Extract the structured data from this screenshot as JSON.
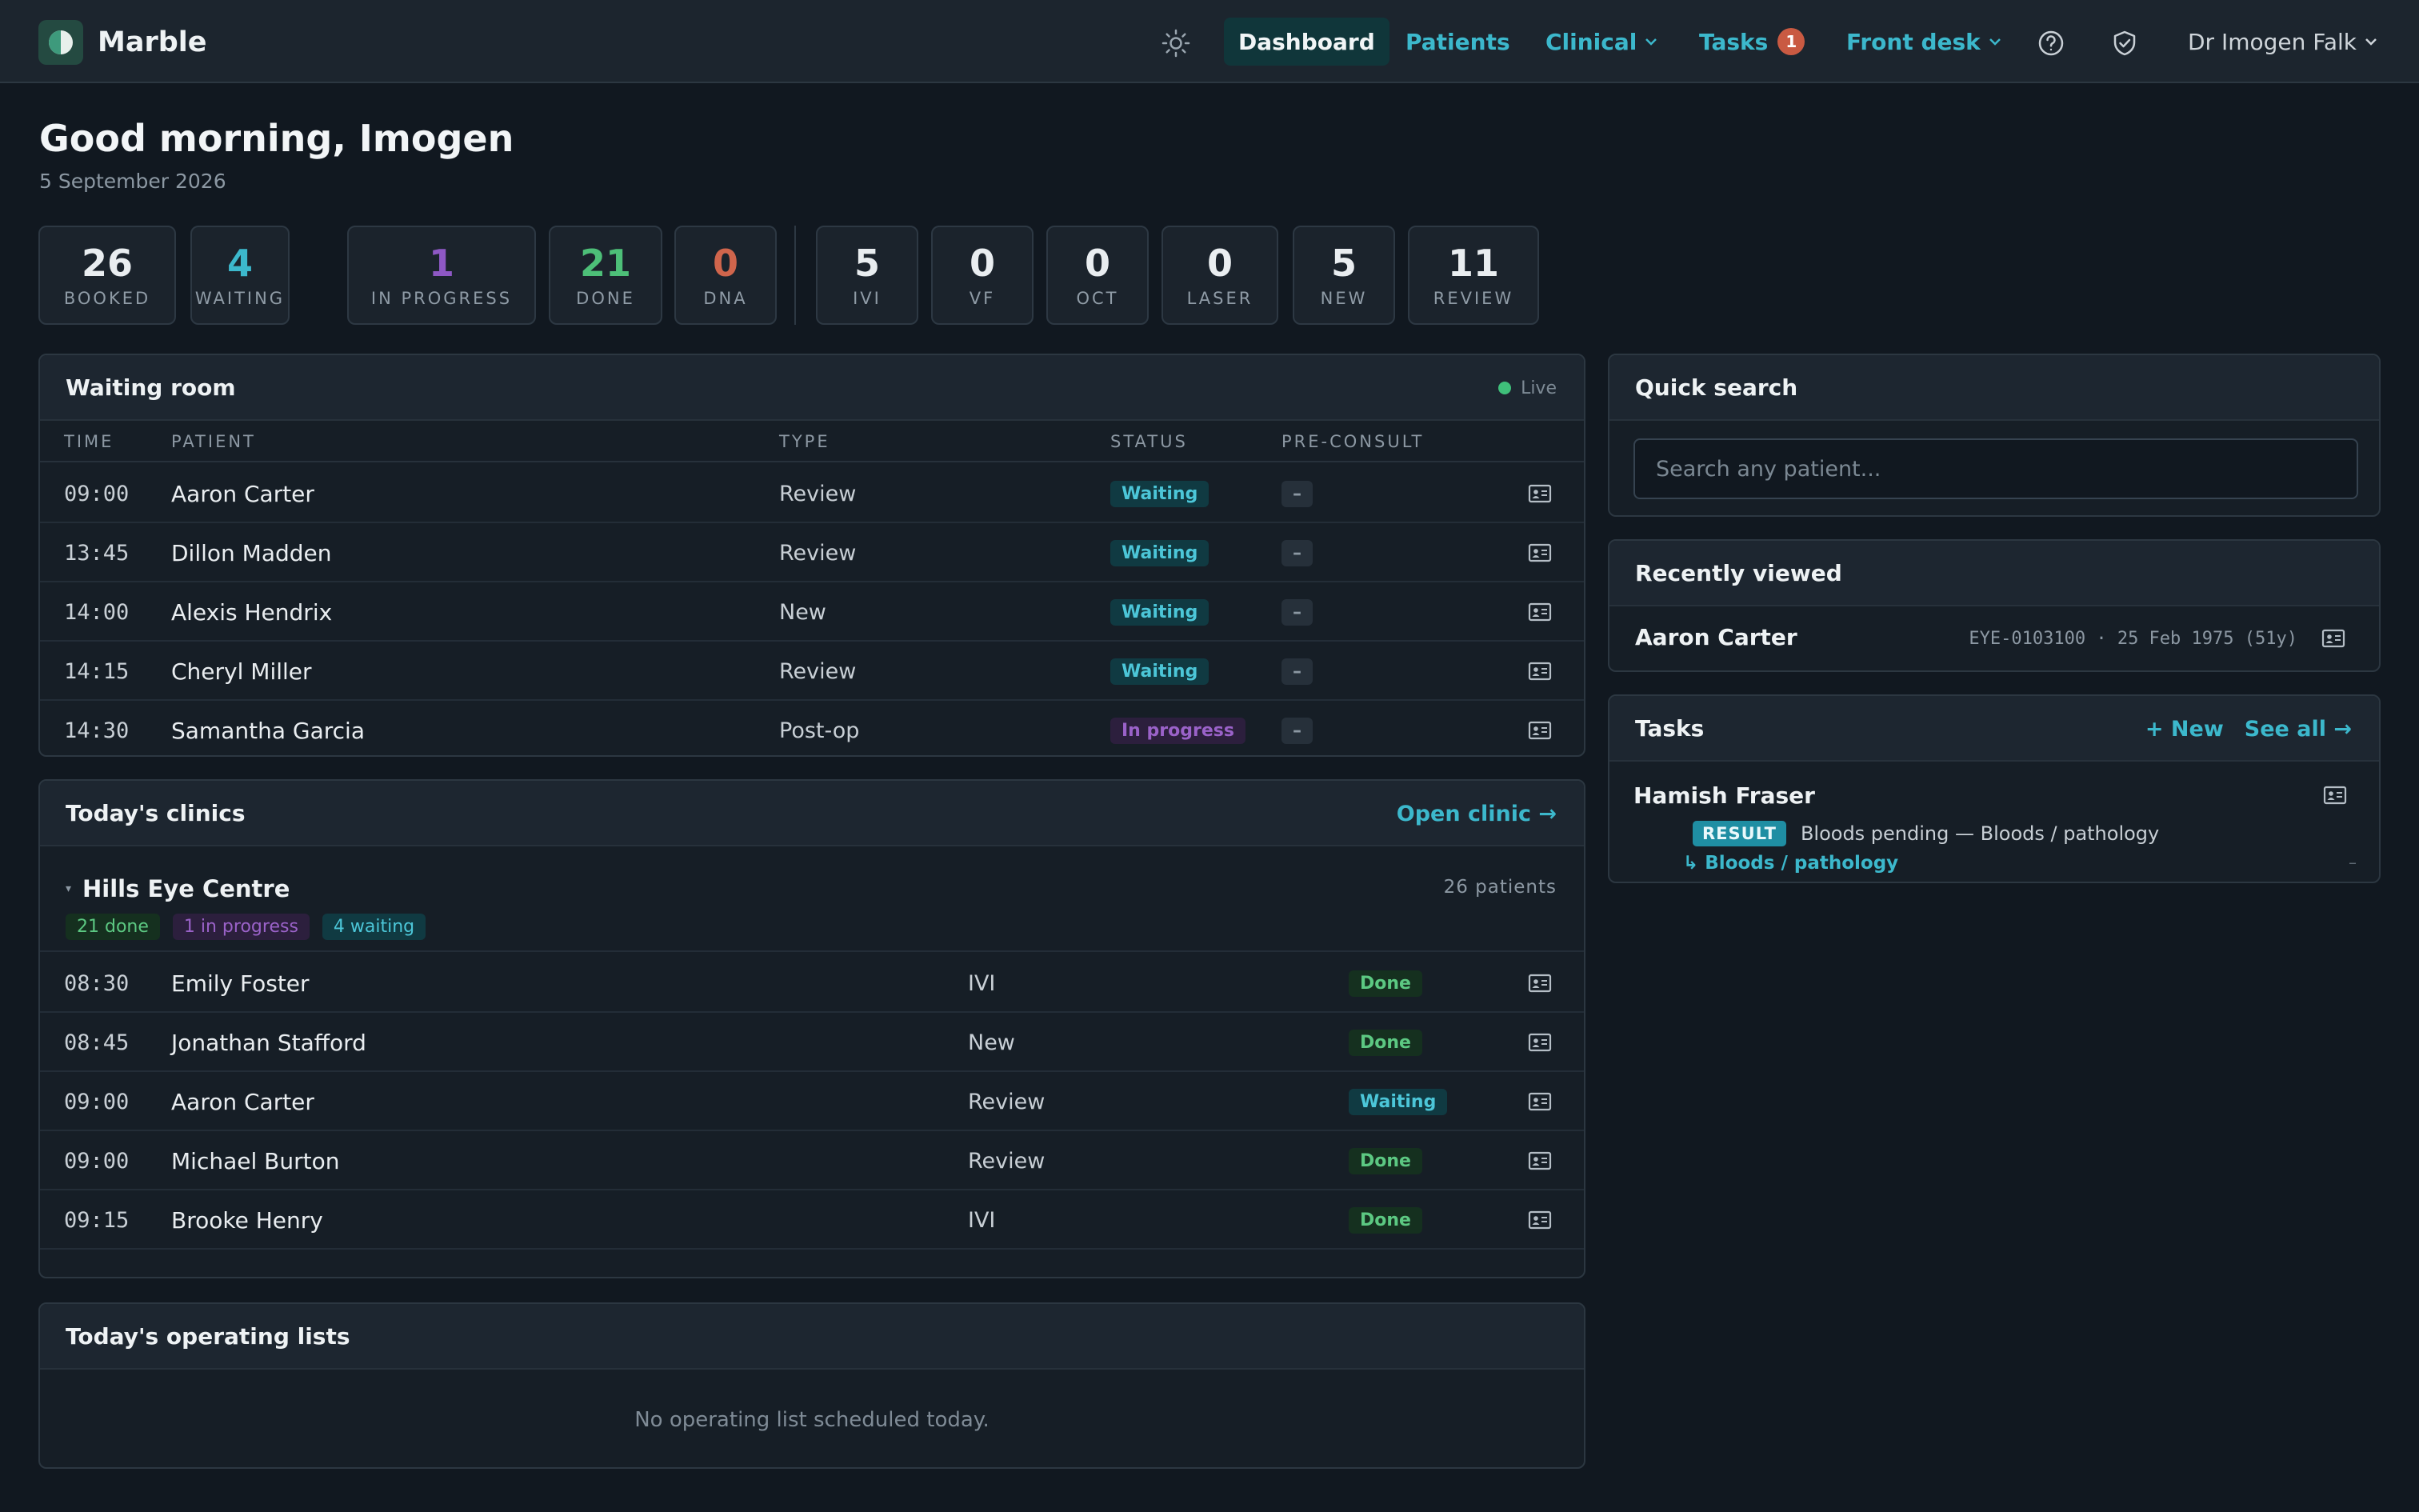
{
  "app": {
    "name": "Marble"
  },
  "nav": {
    "dashboard": "Dashboard",
    "patients": "Patients",
    "clinical": "Clinical",
    "tasks": "Tasks",
    "tasks_count": "1",
    "front_desk": "Front desk",
    "user": "Dr Imogen Falk"
  },
  "greeting": {
    "title": "Good morning, Imogen",
    "date": "5 September 2026"
  },
  "stats": [
    {
      "value": "26",
      "label": "BOOKED",
      "color": "#e9edf0"
    },
    {
      "value": "4",
      "label": "WAITING",
      "color": "#3cb8cc"
    },
    {
      "value": "1",
      "label": "IN PROGRESS",
      "color": "#8e58c4"
    },
    {
      "value": "21",
      "label": "DONE",
      "color": "#4dbf78"
    },
    {
      "value": "0",
      "label": "DNA",
      "color": "#d0654c"
    },
    {
      "value": "5",
      "label": "IVI",
      "color": "#e9edf0"
    },
    {
      "value": "0",
      "label": "VF",
      "color": "#e9edf0"
    },
    {
      "value": "0",
      "label": "OCT",
      "color": "#e9edf0"
    },
    {
      "value": "0",
      "label": "LASER",
      "color": "#e9edf0"
    },
    {
      "value": "5",
      "label": "NEW",
      "color": "#e9edf0"
    },
    {
      "value": "11",
      "label": "REVIEW",
      "color": "#e9edf0"
    }
  ],
  "waiting_room": {
    "title": "Waiting room",
    "live": "Live",
    "columns": {
      "time": "TIME",
      "patient": "PATIENT",
      "type": "TYPE",
      "status": "STATUS",
      "preconsult": "PRE-CONSULT"
    },
    "rows": [
      {
        "time": "09:00",
        "patient": "Aaron Carter",
        "type": "Review",
        "status": "Waiting",
        "preconsult": "–"
      },
      {
        "time": "13:45",
        "patient": "Dillon Madden",
        "type": "Review",
        "status": "Waiting",
        "preconsult": "–"
      },
      {
        "time": "14:00",
        "patient": "Alexis Hendrix",
        "type": "New",
        "status": "Waiting",
        "preconsult": "–"
      },
      {
        "time": "14:15",
        "patient": "Cheryl Miller",
        "type": "Review",
        "status": "Waiting",
        "preconsult": "–"
      },
      {
        "time": "14:30",
        "patient": "Samantha Garcia",
        "type": "Post-op",
        "status": "In progress",
        "preconsult": "–"
      }
    ]
  },
  "clinics": {
    "title": "Today's clinics",
    "open_link": "Open clinic →",
    "site": "Hills Eye Centre",
    "patients_count": "26 patients",
    "summary": {
      "done": "21 done",
      "in_progress": "1 in progress",
      "waiting": "4 waiting"
    },
    "rows": [
      {
        "time": "08:30",
        "patient": "Emily Foster",
        "type": "IVI",
        "status": "Done"
      },
      {
        "time": "08:45",
        "patient": "Jonathan Stafford",
        "type": "New",
        "status": "Done"
      },
      {
        "time": "09:00",
        "patient": "Aaron Carter",
        "type": "Review",
        "status": "Waiting"
      },
      {
        "time": "09:00",
        "patient": "Michael Burton",
        "type": "Review",
        "status": "Done"
      },
      {
        "time": "09:15",
        "patient": "Brooke Henry",
        "type": "IVI",
        "status": "Done"
      }
    ]
  },
  "operating": {
    "title": "Today's operating lists",
    "empty": "No operating list scheduled today."
  },
  "quick_search": {
    "title": "Quick search",
    "placeholder": "Search any patient..."
  },
  "recent": {
    "title": "Recently viewed",
    "patient": "Aaron Carter",
    "meta": "EYE-0103100 · 25 Feb 1975 (51y)"
  },
  "tasks": {
    "title": "Tasks",
    "new": "+ New",
    "see_all": "See all →",
    "item": {
      "patient": "Hamish Fraser",
      "tag": "RESULT",
      "text": "Bloods pending — Bloods / pathology",
      "link": "↳ Bloods / pathology",
      "trailing": "–"
    }
  }
}
